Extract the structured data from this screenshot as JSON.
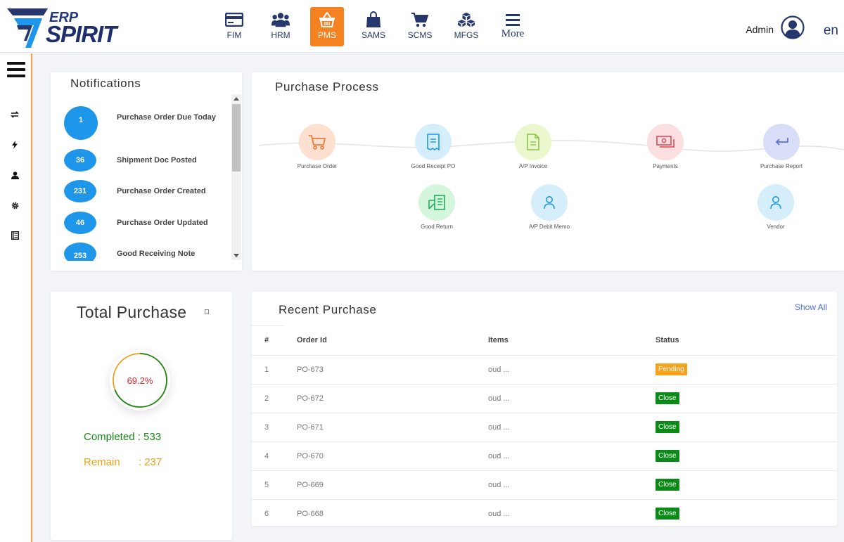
{
  "brand": {
    "erp": "ERP",
    "spirit": "SPIRIT",
    "accent": "#f58220",
    "navy": "#26376e"
  },
  "modules": [
    {
      "label": "FIM",
      "icon": "credit-card-icon"
    },
    {
      "label": "HRM",
      "icon": "users-icon"
    },
    {
      "label": "PMS",
      "icon": "basket-icon",
      "active": true
    },
    {
      "label": "SAMS",
      "icon": "shopping-bag-icon"
    },
    {
      "label": "SCMS",
      "icon": "cart-icon"
    },
    {
      "label": "MFGS",
      "icon": "cubes-icon"
    },
    {
      "label": "More",
      "icon": "menu-icon"
    }
  ],
  "user": {
    "name": "Admin",
    "lang": "en"
  },
  "notifications": {
    "title": "Notifications",
    "items": [
      {
        "count": "1",
        "text": "Purchase Order Due Today"
      },
      {
        "count": "36",
        "text": "Shipment Doc Posted"
      },
      {
        "count": "231",
        "text": "Purchase Order Created"
      },
      {
        "count": "46",
        "text": "Purchase Order Updated"
      },
      {
        "count": "253",
        "text": "Good Receiving Note"
      }
    ]
  },
  "process": {
    "title": "Purchase Process",
    "steps": [
      {
        "label": "Purchase Order",
        "icon": "cart-icon"
      },
      {
        "label": "Good Receipt PO",
        "icon": "receipt-icon"
      },
      {
        "label": "A/P Invoice",
        "icon": "document-icon"
      },
      {
        "label": "Payments",
        "icon": "money-icon"
      },
      {
        "label": "Purchase Report",
        "icon": "return-arrow-icon"
      },
      {
        "label": "Good Return",
        "icon": "return-box-icon"
      },
      {
        "label": "A/P Debit Memo",
        "icon": "user-icon"
      },
      {
        "label": "Vendor",
        "icon": "user-icon"
      }
    ]
  },
  "total": {
    "title": "Total Purchase",
    "percent": "69.2%",
    "percent_value": 0.692,
    "completed_label": "Completed",
    "completed_value": ": 533",
    "remain_label": "Remain",
    "remain_value": ": 237",
    "completed_color": "#1a8a1a",
    "remain_color": "#f0a019"
  },
  "recent": {
    "title": "Recent Purchase",
    "show_all": "Show All",
    "columns": [
      "#",
      "Order Id",
      "Items",
      "Status"
    ],
    "rows": [
      {
        "n": "1",
        "id": "PO-673",
        "items": "oud ...",
        "status": "Pending",
        "color": "#f7a21b"
      },
      {
        "n": "2",
        "id": "PO-672",
        "items": "oud ...",
        "status": "Close",
        "color": "#0b8a17"
      },
      {
        "n": "3",
        "id": "PO-671",
        "items": "oud ...",
        "status": "Close",
        "color": "#0b8a17"
      },
      {
        "n": "4",
        "id": "PO-670",
        "items": "oud ...",
        "status": "Close",
        "color": "#0b8a17"
      },
      {
        "n": "5",
        "id": "PO-669",
        "items": "oud ...",
        "status": "Close",
        "color": "#0b8a17"
      },
      {
        "n": "6",
        "id": "PO-668",
        "items": "oud ...",
        "status": "Close",
        "color": "#0b8a17"
      }
    ]
  }
}
